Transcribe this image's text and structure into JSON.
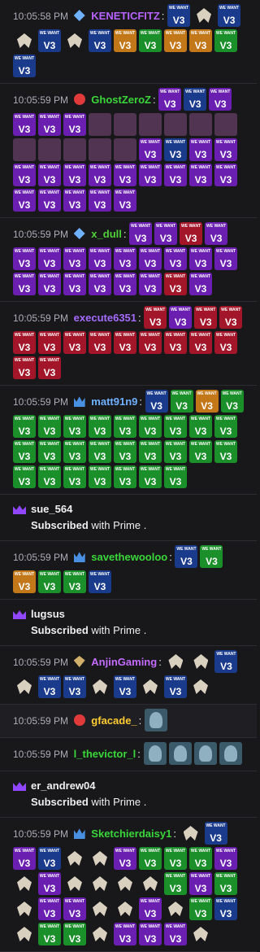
{
  "messages": [
    {
      "id": "m1",
      "time": "10:05:58 PM",
      "badge": "sub",
      "name": "KENETICFITZ",
      "color": "#b763ff",
      "emotes": [
        "v3",
        "ghost",
        "v3",
        "ghost",
        "v3",
        "ghost",
        "v3",
        "orange",
        "green",
        "orange",
        "orange",
        "green",
        "v3"
      ]
    },
    {
      "id": "m2",
      "time": "10:05:59 PM",
      "badge": "heart",
      "name": "GhostZeroZ",
      "color": "#3ad63a",
      "emotes": [
        "purple",
        "v3",
        "purple",
        "purple",
        "purple",
        "purple",
        "blur",
        "blur",
        "blur",
        "blur",
        "blur",
        "blur",
        "blur",
        "blur",
        "blur",
        "blur",
        "blur",
        "purple",
        "v3",
        "purple",
        "purple",
        "purple",
        "purple",
        "purple",
        "purple",
        "purple",
        "purple",
        "purple",
        "purple",
        "purple",
        "purple",
        "purple",
        "purple",
        "purple",
        "purple"
      ]
    },
    {
      "id": "m3",
      "time": "10:05:59 PM",
      "badge": "sub",
      "name": "x_dull",
      "color": "#4fd13a",
      "emotes": [
        "purple",
        "purple",
        "red",
        "purple",
        "purple",
        "purple",
        "purple",
        "purple",
        "purple",
        "purple",
        "purple",
        "purple",
        "purple",
        "purple",
        "purple",
        "purple",
        "purple",
        "purple",
        "purple",
        "red",
        "purple"
      ]
    },
    {
      "id": "m4",
      "time": "10:05:59 PM",
      "badge": "none",
      "name": "execute6351",
      "color": "#a56bff",
      "emotes": [
        "red",
        "purple",
        "red",
        "red",
        "red",
        "red",
        "red",
        "red",
        "red",
        "red",
        "red",
        "red",
        "red",
        "red",
        "red"
      ]
    },
    {
      "id": "m5",
      "time": "10:05:59 PM",
      "badge": "crown",
      "name": "matt91n9",
      "color": "#6fb1ff",
      "emotes": [
        "v3",
        "green",
        "orange",
        "green",
        "green",
        "green",
        "green",
        "green",
        "green",
        "green",
        "green",
        "green",
        "green",
        "green",
        "green",
        "green",
        "green",
        "green",
        "green",
        "green",
        "green",
        "green",
        "green",
        "green",
        "green",
        "green",
        "green",
        "green",
        "green"
      ]
    }
  ],
  "sys1": {
    "name": "sue_564",
    "text_bold": "Subscribed",
    "text_rest": " with Prime ."
  },
  "m6": {
    "time": "10:05:59 PM",
    "badge": "crown",
    "name": "savethewooloo",
    "color": "#3ad63a",
    "emotes": [
      "v3",
      "green",
      "orange",
      "green",
      "green",
      "v3"
    ]
  },
  "sys2": {
    "name": "lugsus",
    "text_bold": "Subscribed",
    "text_rest": " with Prime ."
  },
  "m7": {
    "time": "10:05:59 PM",
    "badge": "bits",
    "name": "AnjinGaming",
    "color": "#c46bff",
    "emotes": [
      "ghost",
      "ghost",
      "v3",
      "ghost",
      "v3",
      "v3",
      "ghost",
      "v3",
      "ghost",
      "v3",
      "ghost"
    ]
  },
  "m8": {
    "time": "10:05:59 PM",
    "badge": "heart",
    "name": "gfacade_",
    "color": "#ffcc33",
    "emotes": [
      "pic"
    ]
  },
  "m9": {
    "time": "10:05:59 PM",
    "badge": "none",
    "name": "l_thevictor_l",
    "color": "#3ad63a",
    "emotes": [
      "pic",
      "pic",
      "pic",
      "pic"
    ]
  },
  "sys3": {
    "name": "er_andrew04",
    "text_bold": "Subscribed",
    "text_rest": " with Prime ."
  },
  "m10": {
    "time": "10:05:59 PM",
    "badge": "crown",
    "name": "Sketchierdaisy1",
    "color": "#3ad63a",
    "emotes": [
      "ghost",
      "v3",
      "purple",
      "v3",
      "ghost",
      "ghost",
      "purple",
      "green",
      "green",
      "green",
      "purple",
      "ghost",
      "purple",
      "ghost",
      "ghost",
      "ghost",
      "ghost",
      "green",
      "purple",
      "green",
      "ghost",
      "purple",
      "purple",
      "ghost",
      "ghost",
      "purple",
      "ghost",
      "green",
      "v3",
      "ghost",
      "green",
      "green",
      "ghost",
      "purple",
      "purple",
      "purple",
      "ghost"
    ]
  },
  "emote_text": {
    "top": "WE WANT",
    "bottom": "V3"
  }
}
